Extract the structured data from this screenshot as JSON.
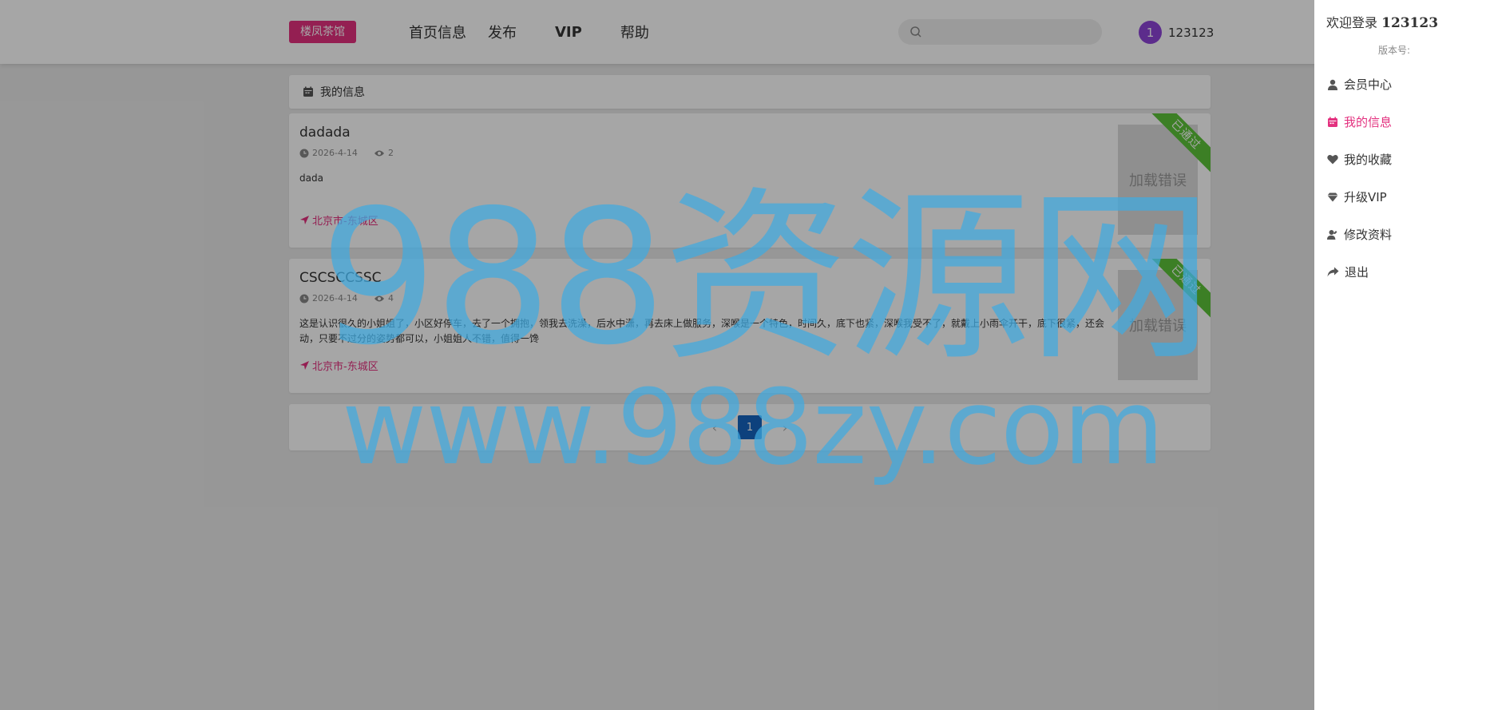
{
  "header": {
    "logo": "楼凤茶馆",
    "nav": [
      "首页信息",
      "发布",
      "VIP",
      "帮助"
    ],
    "search": {
      "value": "",
      "placeholder": ""
    },
    "user": {
      "avatar_text": "1",
      "name": "123123"
    }
  },
  "main": {
    "section_title": "我的信息",
    "cards": [
      {
        "title": "dadada",
        "date": "2026-4-14",
        "views": "2",
        "desc": "dada",
        "location": "北京市-东城区",
        "thumb_text": "加载错误",
        "badge": "已通过"
      },
      {
        "title": "CSCSCCSSC",
        "date": "2026-4-14",
        "views": "4",
        "desc": "这是认识很久的小姐姐了，小区好停车，去了一个拥抱，领我去洗澡，后水中潇，再去床上做服务，深喉是一个特色，时间久，底下也紧，深喉我受不了，就戴上小雨伞开干，底下很紧，还会动，只要不过分的姿势都可以，小姐姐人不错，值得一馋",
        "location": "北京市-东城区",
        "thumb_text": "加载错误",
        "badge": "已通过"
      }
    ],
    "pager": {
      "current": "1"
    }
  },
  "drawer": {
    "welcome": "欢迎登录",
    "username": "123123",
    "version": "版本号:",
    "menu": [
      {
        "label": "会员中心",
        "icon": "user-icon"
      },
      {
        "label": "我的信息",
        "icon": "calendar-icon",
        "active": true
      },
      {
        "label": "我的收藏",
        "icon": "heart-icon"
      },
      {
        "label": "升级VIP",
        "icon": "diamond-icon"
      },
      {
        "label": "修改资料",
        "icon": "user-edit-icon"
      },
      {
        "label": "退出",
        "icon": "share-icon"
      }
    ]
  },
  "watermark": {
    "line1": "988资源网",
    "line2": "www.988zy.com"
  },
  "colors": {
    "brand": "#e3317f",
    "badge": "#5cc43a",
    "page_active": "#1565c0",
    "avatar": "#8e44d8",
    "watermark": "#40aae1"
  }
}
